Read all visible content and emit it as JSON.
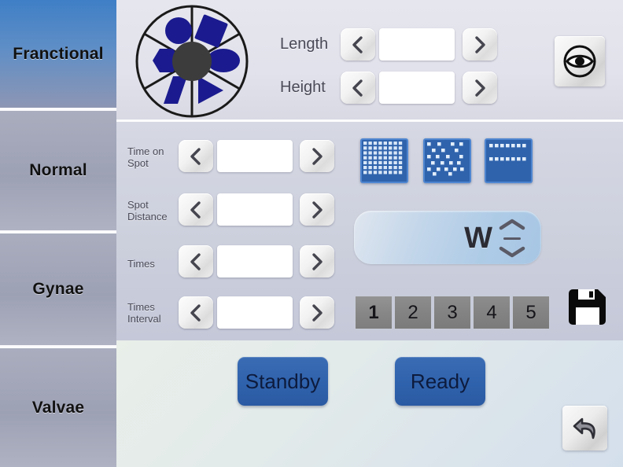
{
  "sidebar": {
    "items": [
      {
        "label": "Franctional",
        "state": "active"
      },
      {
        "label": "Normal",
        "state": "inactive"
      },
      {
        "label": "Gynae",
        "state": "inactive"
      },
      {
        "label": "Valvae",
        "state": "inactive"
      }
    ]
  },
  "top_panel": {
    "shape_wheel": {
      "name": "shape-selector-wheel",
      "hub_color": "#3c3c3c",
      "shape_color": "#1b1b8f",
      "sectors": [
        "circle",
        "square",
        "ellipse",
        "triangle",
        "parallelogram",
        "hexagon"
      ]
    },
    "length": {
      "label": "Length",
      "value": "",
      "placeholder": "",
      "prev_icon": "chevron-left-icon",
      "next_icon": "chevron-right-icon"
    },
    "height": {
      "label": "Height",
      "value": "",
      "placeholder": "",
      "prev_icon": "chevron-left-icon",
      "next_icon": "chevron-right-icon"
    },
    "preview_button": {
      "icon": "eye-icon"
    }
  },
  "mid_panel": {
    "rows": [
      {
        "label_line1": "Time on",
        "label_line2": "Spot",
        "value": "",
        "placeholder": ""
      },
      {
        "label_line1": "Spot",
        "label_line2": "Distance",
        "value": "",
        "placeholder": ""
      },
      {
        "label_line1": "Times",
        "label_line2": "",
        "value": "",
        "placeholder": ""
      },
      {
        "label_line1": "Times",
        "label_line2": "Interval",
        "value": "",
        "placeholder": ""
      }
    ],
    "patterns": [
      {
        "name": "pattern-dense-grid",
        "selected": false
      },
      {
        "name": "pattern-scattered",
        "selected": false
      },
      {
        "name": "pattern-two-rows",
        "selected": false
      }
    ],
    "power": {
      "unit": "W",
      "value": "",
      "up_icon": "chevron-up-icon",
      "dash_icon": "minus-icon",
      "down_icon": "chevron-down-icon"
    },
    "numbers": [
      {
        "label": "1",
        "selected": true
      },
      {
        "label": "2",
        "selected": false
      },
      {
        "label": "3",
        "selected": false
      },
      {
        "label": "4",
        "selected": false
      },
      {
        "label": "5",
        "selected": false
      }
    ],
    "save_button": {
      "icon": "floppy-disk-icon"
    }
  },
  "bottom_panel": {
    "standby": {
      "label": "Standby"
    },
    "ready": {
      "label": "Ready"
    },
    "back_button": {
      "icon": "undo-arrow-icon"
    }
  },
  "colors": {
    "accent_blue": "#2f62ac",
    "shape_blue": "#1b1b8f",
    "sidebar_active": "#3f7fc6",
    "sidebar_inactive": "#a9adbe",
    "panel_top": "#e4e4ee",
    "panel_mid": "#ccd0dd",
    "panel_bottom": "#e4ebe9"
  }
}
